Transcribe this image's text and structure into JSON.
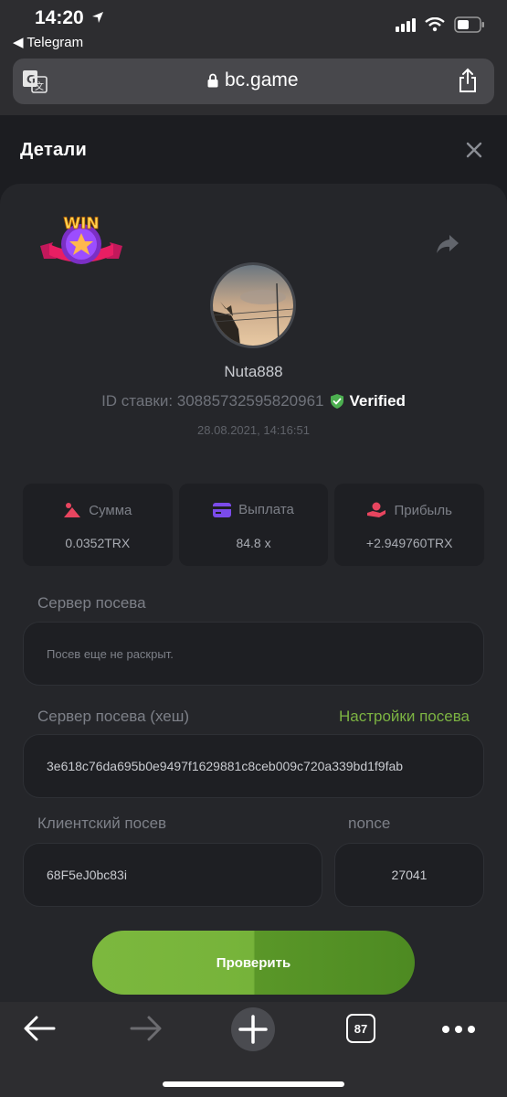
{
  "status_bar": {
    "time": "14:20",
    "back_app": "◀ Telegram"
  },
  "browser": {
    "url": "bc.game"
  },
  "modal": {
    "title": "Детали",
    "username": "Nuta888",
    "bet_id": "ID ставки: 30885732595820961",
    "verified": "Verified",
    "datetime": "28.08.2021, 14:16:51",
    "badge_text": "WIN",
    "stats": [
      {
        "label": "Сумма",
        "value": "0.0352TRX",
        "icon": "amount-icon"
      },
      {
        "label": "Выплата",
        "value": "84.8 x",
        "icon": "payout-icon"
      },
      {
        "label": "Прибыль",
        "value": "+2.949760TRX",
        "icon": "profit-icon"
      }
    ],
    "server_seed_label": "Сервер посева",
    "server_seed_value": "Посев еще не раскрыт.",
    "server_hash_label": "Сервер посева (хеш)",
    "seed_settings_link": "Настройки посева",
    "server_hash_value": "3e618c76da695b0e9497f1629881c8ceb009c720a339bd1f9fab",
    "client_seed_label": "Клиентский посев",
    "client_seed_value": "68F5eJ0bc83i",
    "nonce_label": "nonce",
    "nonce_value": "27041",
    "verify_button": "Проверить"
  },
  "toolbar": {
    "tabs_count": "87"
  },
  "colors": {
    "accent_green": "#7cb342",
    "verified_green": "#4caf50",
    "stat_icon_pink": "#e8455f",
    "stat_icon_purple": "#7b4bea"
  }
}
